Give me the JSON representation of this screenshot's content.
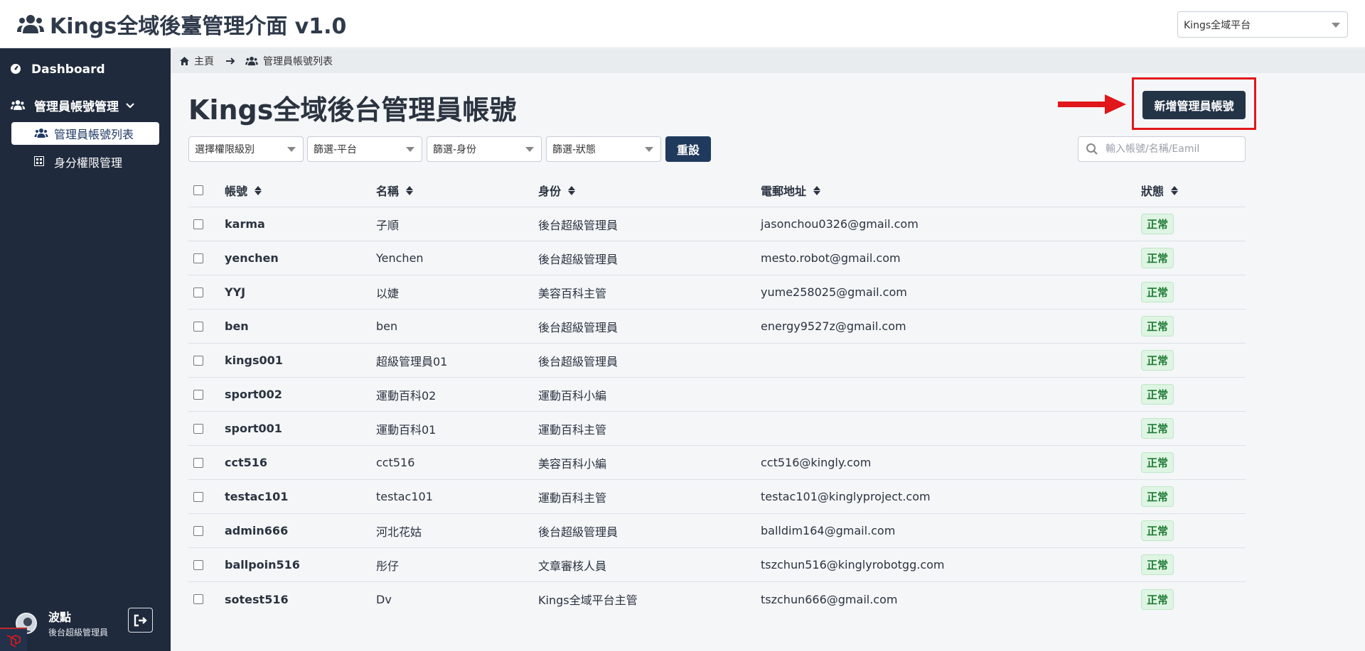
{
  "header": {
    "title": "Kings全域後臺管理介面 v1.0",
    "platform_select": "Kings全域平台"
  },
  "sidebar": {
    "dashboard": "Dashboard",
    "admin_group": "管理員帳號管理",
    "admin_list": "管理員帳號列表",
    "role_perm": "身分權限管理",
    "user_name": "波點",
    "user_role": "後台超級管理員"
  },
  "breadcrumb": {
    "home": "主頁",
    "current": "管理員帳號列表"
  },
  "main": {
    "page_title": "Kings全域後台管理員帳號",
    "add_button": "新增管理員帳號",
    "filters": [
      "選擇權限級別",
      "篩選-平台",
      "篩選-身份",
      "篩選-狀態"
    ],
    "reset_button": "重設",
    "search_placeholder": "輸入帳號/名稱/Eamil"
  },
  "table": {
    "columns": [
      "帳號",
      "名稱",
      "身份",
      "電郵地址",
      "狀態"
    ],
    "rows": [
      {
        "account": "karma",
        "name": "子順",
        "role": "後台超級管理員",
        "email": "jasonchou0326@gmail.com",
        "status": "正常"
      },
      {
        "account": "yenchen",
        "name": "Yenchen",
        "role": "後台超級管理員",
        "email": "mesto.robot@gmail.com",
        "status": "正常"
      },
      {
        "account": "YYJ",
        "name": "以婕",
        "role": "美容百科主管",
        "email": "yume258025@gmail.com",
        "status": "正常"
      },
      {
        "account": "ben",
        "name": "ben",
        "role": "後台超級管理員",
        "email": "energy9527z@gmail.com",
        "status": "正常"
      },
      {
        "account": "kings001",
        "name": "超級管理員01",
        "role": "後台超級管理員",
        "email": "",
        "status": "正常"
      },
      {
        "account": "sport002",
        "name": "運動百科02",
        "role": "運動百科小編",
        "email": "",
        "status": "正常"
      },
      {
        "account": "sport001",
        "name": "運動百科01",
        "role": "運動百科主管",
        "email": "",
        "status": "正常"
      },
      {
        "account": "cct516",
        "name": "cct516",
        "role": "美容百科小編",
        "email": "cct516@kingly.com",
        "status": "正常"
      },
      {
        "account": "testac101",
        "name": "testac101",
        "role": "運動百科主管",
        "email": "testac101@kinglyproject.com",
        "status": "正常"
      },
      {
        "account": "admin666",
        "name": "河北花姑",
        "role": "後台超級管理員",
        "email": "balldim164@gmail.com",
        "status": "正常"
      },
      {
        "account": "ballpoin516",
        "name": "彤仔",
        "role": "文章審核人員",
        "email": "tszchun516@kinglyrobotgg.com",
        "status": "正常"
      },
      {
        "account": "sotest516",
        "name": "Dv",
        "role": "Kings全域平台主管",
        "email": "tszchun666@gmail.com",
        "status": "正常"
      }
    ]
  },
  "colors": {
    "sidebar_bg": "#1f2a3c",
    "primary_button": "#243447",
    "highlight": "#e0171b",
    "status_green": "#1e7b34"
  }
}
